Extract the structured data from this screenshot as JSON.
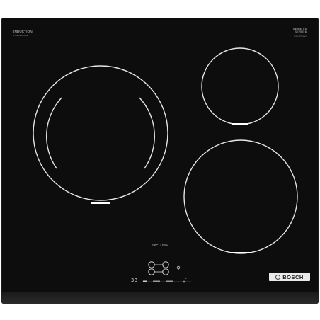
{
  "labels": {
    "top_left": "INDUCTION",
    "top_left_sub": "PUE631BB5E",
    "top_right_line1": "SERIE | 6",
    "top_right_line2": "SERIE 6",
    "top_right_sub": "ExtraPower",
    "center": "EXCLUSIV",
    "brand": "BOSCH"
  },
  "controls": {
    "timer_display": "3B"
  },
  "colors": {
    "glass": "#0d0d0d",
    "ring": "#e6e6e6",
    "badge": "#e9e9e9"
  }
}
